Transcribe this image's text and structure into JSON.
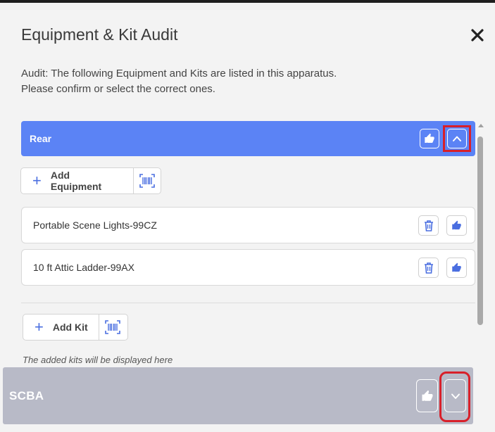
{
  "dialog": {
    "title": "Equipment & Kit Audit",
    "close_icon": "close-icon",
    "description_line1": "Audit: The following Equipment and Kits are listed in this apparatus.",
    "description_line2": "Please confirm or select the correct ones."
  },
  "rear_section": {
    "title": "Rear",
    "confirm_icon": "thumbs-up-icon",
    "collapse_icon": "chevron-up-icon",
    "header_color": "#5b83f5"
  },
  "add_equipment": {
    "label": "Add Equipment",
    "plus_icon": "plus-icon",
    "scan_icon": "barcode-scan-icon"
  },
  "equipment_items": [
    {
      "label": "Portable Scene Lights-99CZ",
      "delete_icon": "trash-icon",
      "confirm_icon": "thumbs-up-icon"
    },
    {
      "label": "10 ft Attic Ladder-99AX",
      "delete_icon": "trash-icon",
      "confirm_icon": "thumbs-up-icon"
    }
  ],
  "add_kit": {
    "label": "Add Kit",
    "plus_icon": "plus-icon",
    "scan_icon": "barcode-scan-icon"
  },
  "kits_hint": "The added kits will be displayed here",
  "scba_section": {
    "title": "SCBA",
    "confirm_icon": "thumbs-up-icon",
    "expand_icon": "chevron-down-icon",
    "header_color": "#b8bac7"
  },
  "colors": {
    "accent": "#5b83f5",
    "highlight": "#d8202a",
    "icon_blue": "#4a6ee0"
  }
}
